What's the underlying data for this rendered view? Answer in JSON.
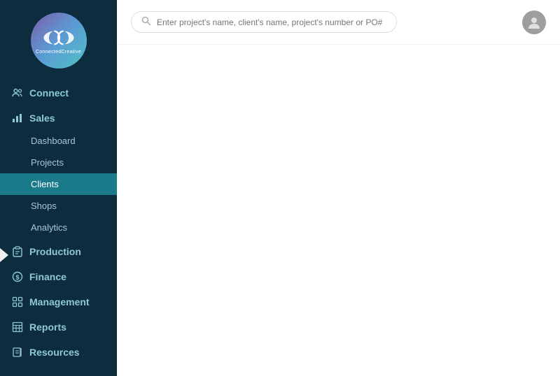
{
  "sidebar": {
    "logo": {
      "text": "ConnectedCreative"
    },
    "sections": [
      {
        "id": "connect",
        "label": "Connect",
        "icon": "people-icon",
        "subitems": []
      },
      {
        "id": "sales",
        "label": "Sales",
        "icon": "bar-chart-icon",
        "subitems": [
          {
            "id": "dashboard",
            "label": "Dashboard",
            "active": false
          },
          {
            "id": "projects",
            "label": "Projects",
            "active": false
          },
          {
            "id": "clients",
            "label": "Clients",
            "active": true
          },
          {
            "id": "shops",
            "label": "Shops",
            "active": false
          },
          {
            "id": "analytics",
            "label": "Analytics",
            "active": false
          }
        ]
      },
      {
        "id": "production",
        "label": "Production",
        "icon": "clipboard-icon",
        "subitems": []
      },
      {
        "id": "finance",
        "label": "Finance",
        "icon": "dollar-icon",
        "subitems": []
      },
      {
        "id": "management",
        "label": "Management",
        "icon": "grid-icon",
        "subitems": []
      },
      {
        "id": "reports",
        "label": "Reports",
        "icon": "table-icon",
        "subitems": []
      },
      {
        "id": "resources",
        "label": "Resources",
        "icon": "book-icon",
        "subitems": []
      }
    ]
  },
  "topbar": {
    "search_placeholder": "Enter project's name, client's name, project's number or PO#"
  },
  "colors": {
    "sidebar_bg": "#0d2d3f",
    "active_item": "#1a7a8a",
    "accent": "#4fc3c3"
  }
}
